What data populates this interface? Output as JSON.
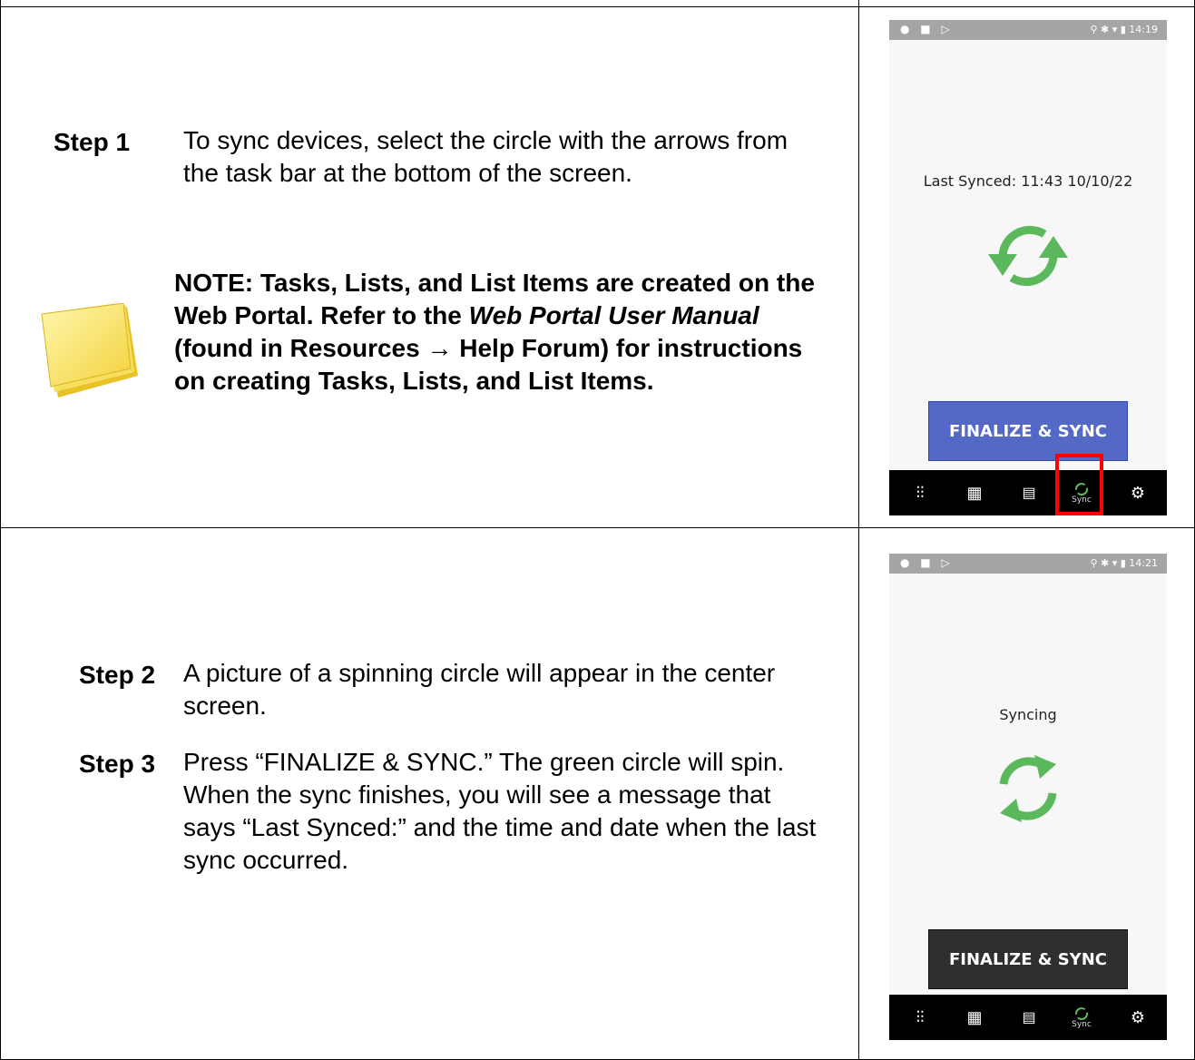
{
  "rows": [
    {
      "steps": [
        {
          "label": "Step 1",
          "text": "To sync devices, select the circle with the arrows from the task bar at the bottom of the screen."
        }
      ],
      "note": {
        "part1": "NOTE: Tasks, Lists, and List Items are created on the Web Portal. Refer to the ",
        "italic": "Web Portal User Manual",
        "part2": " (found in Resources → Help Forum) for instructions on creating Tasks, Lists, and List Items."
      },
      "phone": {
        "status_time": "14:19",
        "message": "Last Synced: 11:43 10/10/22",
        "button_label": "FINALIZE & SYNC",
        "sync_tab_label": "Sync",
        "accent": "#5cb85c",
        "button_color": "#5468c6"
      }
    },
    {
      "steps": [
        {
          "label": "Step 2",
          "text": "A picture of a spinning circle will appear in the center screen."
        },
        {
          "label": "Step 3",
          "text": "Press “FINALIZE & SYNC.” The green circle will spin. When the sync finishes, you will see a message that says “Last Synced:” and the time and date when the last sync occurred."
        }
      ],
      "phone": {
        "status_time": "14:21",
        "message": "Syncing",
        "button_label": "FINALIZE & SYNC",
        "sync_tab_label": "Sync",
        "accent": "#5cb85c",
        "button_color": "#2f2f2f"
      }
    }
  ]
}
